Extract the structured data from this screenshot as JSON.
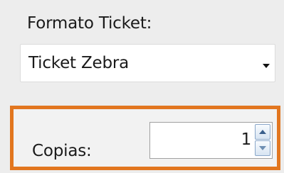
{
  "form": {
    "ticket_format_label": "Formato Ticket:",
    "ticket_format_value": "Ticket Zebra",
    "copies_label": "Copias:",
    "copies_value": "1"
  },
  "icons": {
    "dropdown": "chevron-down-icon",
    "increment": "triangle-up-icon",
    "decrement": "triangle-down-icon"
  },
  "colors": {
    "highlight": "#e2761f",
    "background": "#ededed",
    "input_background": "#ffffff"
  }
}
